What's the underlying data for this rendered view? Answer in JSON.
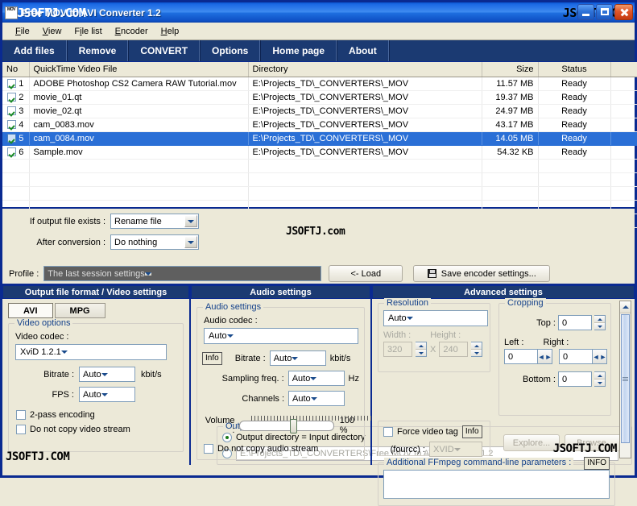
{
  "window": {
    "title": "Free MOV to AVI Converter 1.2",
    "icon": "mov-file-icon",
    "controls": [
      "minimize-button",
      "maximize-button",
      "close-button"
    ]
  },
  "watermark": {
    "text": "JSOFTJ.COM",
    "title_text": "JSOFTJ.COM",
    "dir_text": "JSOFTJ.com"
  },
  "menu": {
    "items": [
      {
        "pre": "",
        "accel": "F",
        "post": "ile"
      },
      {
        "pre": "",
        "accel": "V",
        "post": "iew"
      },
      {
        "pre": "F",
        "accel": "i",
        "post": "le list"
      },
      {
        "pre": "",
        "accel": "E",
        "post": "ncoder"
      },
      {
        "pre": "",
        "accel": "H",
        "post": "elp"
      }
    ]
  },
  "toolbar": {
    "buttons": [
      "Add files",
      "Remove",
      "CONVERT",
      "Options",
      "Home page",
      "About"
    ]
  },
  "filelist": {
    "columns": [
      "No",
      "QuickTime Video File",
      "Directory",
      "Size",
      "Status"
    ],
    "rows": [
      {
        "checked": true,
        "no": "1",
        "file": "ADOBE Photoshop CS2 Camera RAW Tutorial.mov",
        "dir": "E:\\Projects_TD\\_CONVERTERS\\_MOV",
        "size": "11.57 MB",
        "status": "Ready",
        "selected": false
      },
      {
        "checked": true,
        "no": "2",
        "file": "movie_01.qt",
        "dir": "E:\\Projects_TD\\_CONVERTERS\\_MOV",
        "size": "19.37 MB",
        "status": "Ready",
        "selected": false
      },
      {
        "checked": true,
        "no": "3",
        "file": "movie_02.qt",
        "dir": "E:\\Projects_TD\\_CONVERTERS\\_MOV",
        "size": "24.97 MB",
        "status": "Ready",
        "selected": false
      },
      {
        "checked": true,
        "no": "4",
        "file": "cam_0083.mov",
        "dir": "E:\\Projects_TD\\_CONVERTERS\\_MOV",
        "size": "43.17 MB",
        "status": "Ready",
        "selected": false
      },
      {
        "checked": true,
        "no": "5",
        "file": "cam_0084.mov",
        "dir": "E:\\Projects_TD\\_CONVERTERS\\_MOV",
        "size": "14.05 MB",
        "status": "Ready",
        "selected": true
      },
      {
        "checked": true,
        "no": "6",
        "file": "Sample.mov",
        "dir": "E:\\Projects_TD\\_CONVERTERS\\_MOV",
        "size": "54.32 KB",
        "status": "Ready",
        "selected": false
      }
    ]
  },
  "output": {
    "if_exists_label": "If output file exists :",
    "if_exists_value": "Rename file",
    "after_conversion_label": "After conversion :",
    "after_conversion_value": "Do nothing",
    "directory_group": "Output directory",
    "radio_same_label": "Output directory = Input directory",
    "custom_path": "E:\\Projects_TD\\_CONVERTERS\\Free MOV to AVI Converter\\1.2",
    "explore_button": "Explore...",
    "browse_button": "Browse..."
  },
  "profile": {
    "label": "Profile :",
    "value": "The last session settings",
    "load_button": "<- Load",
    "save_button": "Save encoder settings...",
    "save_icon": "floppy-disk-icon"
  },
  "video_panel": {
    "header": "Output file format / Video settings",
    "tabs": [
      "AVI",
      "MPG"
    ],
    "active_tab": "AVI",
    "group": "Video options",
    "codec_label": "Video codec :",
    "codec_value": "XviD 1.2.1",
    "bitrate_label": "Bitrate :",
    "bitrate_value": "Auto",
    "bitrate_unit": "kbit/s",
    "fps_label": "FPS :",
    "fps_value": "Auto",
    "twopass_label": "2-pass encoding",
    "nocopy_label": "Do not copy video stream"
  },
  "audio_panel": {
    "header": "Audio settings",
    "group": "Audio settings",
    "codec_label": "Audio codec :",
    "codec_value": "Auto",
    "info_button": "Info",
    "bitrate_label": "Bitrate :",
    "bitrate_value": "Auto",
    "bitrate_unit": "kbit/s",
    "sampling_label": "Sampling freq. :",
    "sampling_value": "Auto",
    "sampling_unit": "Hz",
    "channels_label": "Channels :",
    "channels_value": "Auto",
    "volume_label": "Volume :",
    "volume_value": "100 %",
    "nocopy_label": "Do not copy audio stream"
  },
  "advanced_panel": {
    "header": "Advanced settings",
    "resolution_group": "Resolution",
    "resolution_value": "Auto",
    "width_label": "Width :",
    "width_value": "320",
    "x_label": "X",
    "height_label": "Height :",
    "height_value": "240",
    "cropping_group": "Cropping",
    "top_label": "Top :",
    "top_value": "0",
    "left_label": "Left :",
    "left_value": "0",
    "right_label": "Right :",
    "right_value": "0",
    "bottom_label": "Bottom :",
    "bottom_value": "0",
    "force_tag_label": "Force video tag",
    "force_tag_info": "Info",
    "fourcc_label": "(fourcc) :",
    "fourcc_value": "XVID",
    "ffmpeg_label": "Additional FFmpeg command-line parameters :",
    "ffmpeg_info": "INFO",
    "ffmpeg_value": ""
  },
  "colors": {
    "titlebar": "#1d6ae5",
    "toolbar": "#1b3a72",
    "selection": "#2a6fd6",
    "window_bg": "#ece9d8",
    "border": "#0a2a91",
    "group_label": "#15428b"
  }
}
